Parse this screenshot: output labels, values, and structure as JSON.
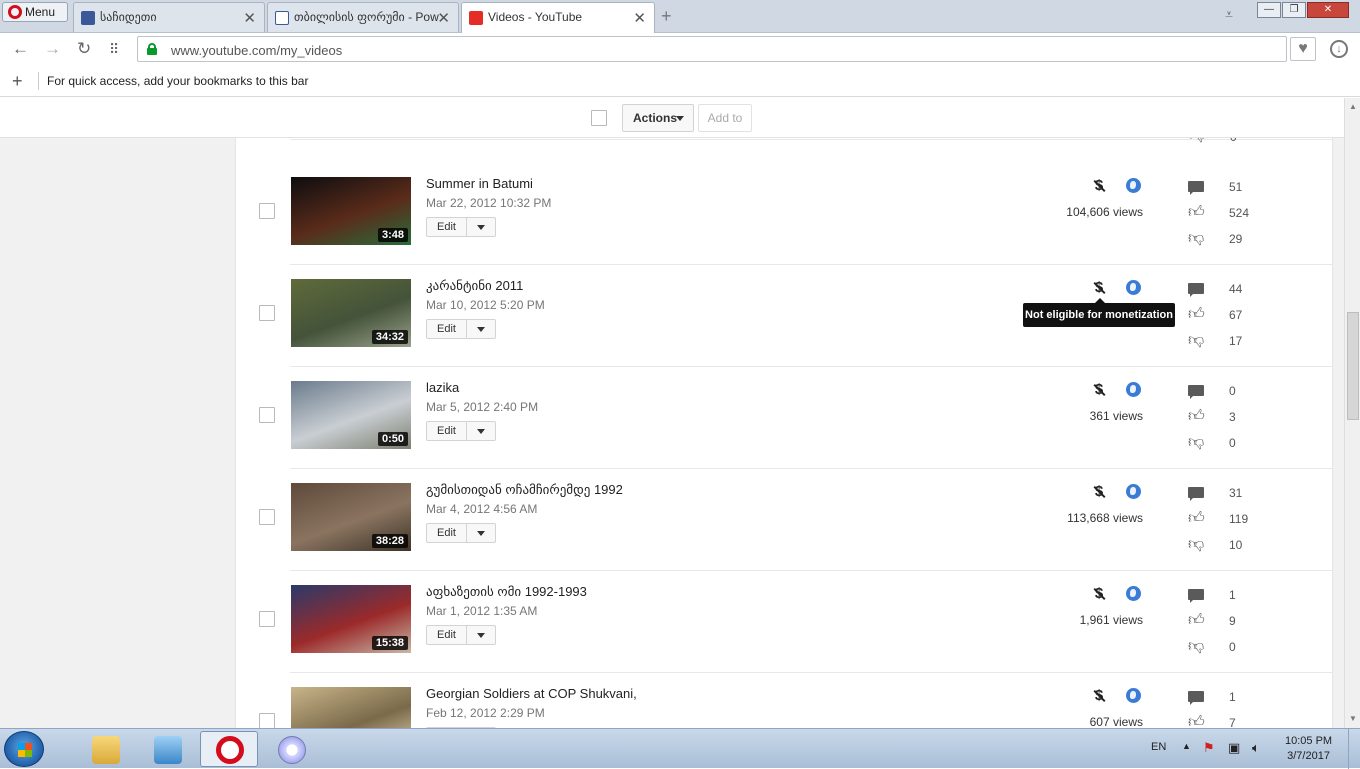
{
  "browser": {
    "menu_label": "Menu",
    "tabs": [
      {
        "title": "საჩიდეთი",
        "favicon": "facebook-icon"
      },
      {
        "title": "თბილისის ფორუმი - Pow",
        "favicon": "forum-icon"
      },
      {
        "title": "Videos - YouTube",
        "favicon": "youtube-icon"
      }
    ],
    "url": "www.youtube.com/my_videos",
    "bookmarks_hint": "For quick access, add your bookmarks to this bar"
  },
  "toolbar": {
    "actions_label": "Actions",
    "add_to_label": "Add to"
  },
  "top_partial_row": {
    "dislikes": "0"
  },
  "videos": [
    {
      "title": "Summer in Batumi",
      "date": "Mar 22, 2012 10:32 PM",
      "duration": "3:48",
      "views": "104,606 views",
      "comments": "51",
      "likes": "524",
      "dislikes": "29",
      "thumb_colors": [
        "#0d0d0f",
        "#5a2b1a",
        "#2a6c3b"
      ]
    },
    {
      "title": "კარანტინი 2011",
      "date": "Mar 10, 2012 5:20 PM",
      "duration": "34:32",
      "views": "",
      "comments": "44",
      "likes": "67",
      "dislikes": "17",
      "thumb_colors": [
        "#5f6b3a",
        "#44533a",
        "#9aa08c"
      ]
    },
    {
      "title": "lazika",
      "date": "Mar 5, 2012 2:40 PM",
      "duration": "0:50",
      "views": "361 views",
      "comments": "0",
      "likes": "3",
      "dislikes": "0",
      "thumb_colors": [
        "#6b7b8c",
        "#c9ced3",
        "#7c8070"
      ]
    },
    {
      "title": "გუმისთიდან ოჩამჩირემდე 1992",
      "date": "Mar 4, 2012 4:56 AM",
      "duration": "38:28",
      "views": "113,668 views",
      "comments": "31",
      "likes": "119",
      "dislikes": "10",
      "thumb_colors": [
        "#5e4a3a",
        "#8a7460",
        "#3e3428"
      ]
    },
    {
      "title": "აფხაზეთის ომი 1992-1993",
      "date": "Mar 1, 2012 1:35 AM",
      "duration": "15:38",
      "views": "1,961 views",
      "comments": "1",
      "likes": "9",
      "dislikes": "0",
      "thumb_colors": [
        "#2a3a6a",
        "#9b2a2a",
        "#c8b8a8"
      ]
    },
    {
      "title": "Georgian Soldiers at COP Shukvani,",
      "date": "Feb 12, 2012 2:29 PM",
      "duration": "",
      "views": "607 views",
      "comments": "1",
      "likes": "7",
      "dislikes": "",
      "thumb_colors": [
        "#c9b48a",
        "#7a6a4a",
        "#e6d8b8"
      ]
    }
  ],
  "edit_label": "Edit",
  "tooltip": "Not eligible for monetization",
  "taskbar": {
    "lang": "EN",
    "time": "10:05 PM",
    "date": "3/7/2017"
  }
}
